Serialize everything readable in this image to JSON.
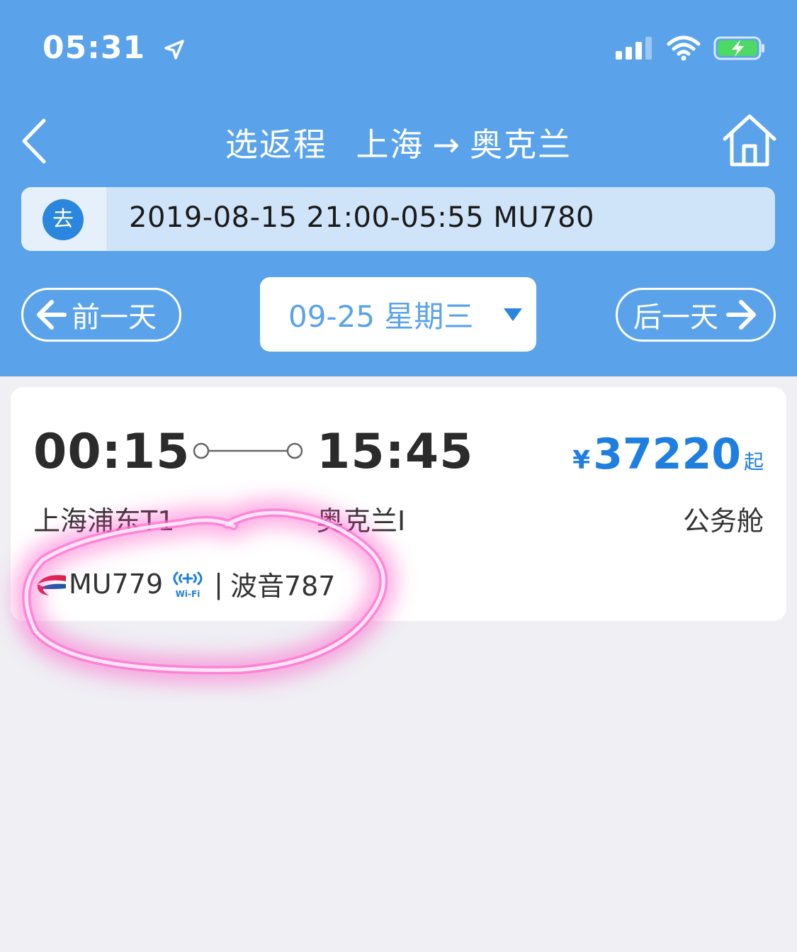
{
  "status_bar": {
    "time": "05:31"
  },
  "nav": {
    "title_part1": "选返程",
    "title_origin": "上海",
    "title_arrow": "→",
    "title_destination": "奥克兰"
  },
  "outbound": {
    "badge": "去",
    "summary": "2019-08-15 21:00-05:55 MU780"
  },
  "date_nav": {
    "prev_label": "前一天",
    "current_date": "09-25 星期三",
    "next_label": "后一天"
  },
  "flight": {
    "dep_time": "00:15",
    "arr_time": "15:45",
    "currency": "¥",
    "price": "37220",
    "price_suffix": "起",
    "dep_airport": "上海浦东T1",
    "arr_airport": "奥克兰I",
    "cabin": "公务舱",
    "flight_no": "MU779",
    "wifi_label": "Wi-Fi",
    "separator": "|",
    "aircraft": "波音787"
  },
  "colors": {
    "header_bg": "#5aa3ea",
    "accent_blue": "#1e7fe0",
    "annotation_pink": "#ff4fc4"
  }
}
